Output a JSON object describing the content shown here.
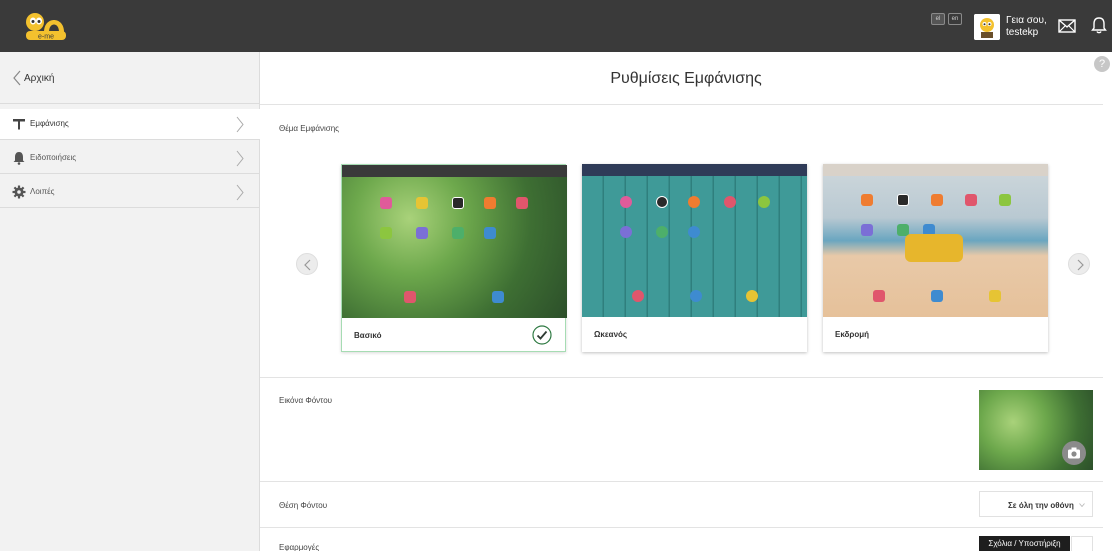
{
  "header": {
    "logo_text": "e-me",
    "lang": [
      "el",
      "en"
    ],
    "greeting_line1": "Γεια σου,",
    "greeting_line2": "testekp"
  },
  "sidebar": {
    "back_label": "Αρχική",
    "items": [
      {
        "label": "Εμφάνισης",
        "icon": "paint-roller-icon"
      },
      {
        "label": "Ειδοποιήσεις",
        "icon": "bell-icon"
      },
      {
        "label": "Λοιπές",
        "icon": "gear-icon"
      }
    ]
  },
  "main": {
    "title": "Ρυθμίσεις Εμφάνισης",
    "theme_label": "Θέμα Εμφάνισης",
    "themes": [
      {
        "name": "Βασικό",
        "selected": true
      },
      {
        "name": "Ωκεανός",
        "selected": false
      },
      {
        "name": "Εκδρομή",
        "selected": false
      }
    ],
    "bg_image_label": "Εικόνα Φόντου",
    "bg_position_label": "Θέση Φόντου",
    "bg_position_value": "Σε όλη την οθόνη",
    "next_label": "Εφαρμογές"
  },
  "tooltip": "Σχόλια / Υποστήριξη",
  "colors": {
    "topbar": "#3a3a3a",
    "accent_check": "#2f7a43"
  }
}
